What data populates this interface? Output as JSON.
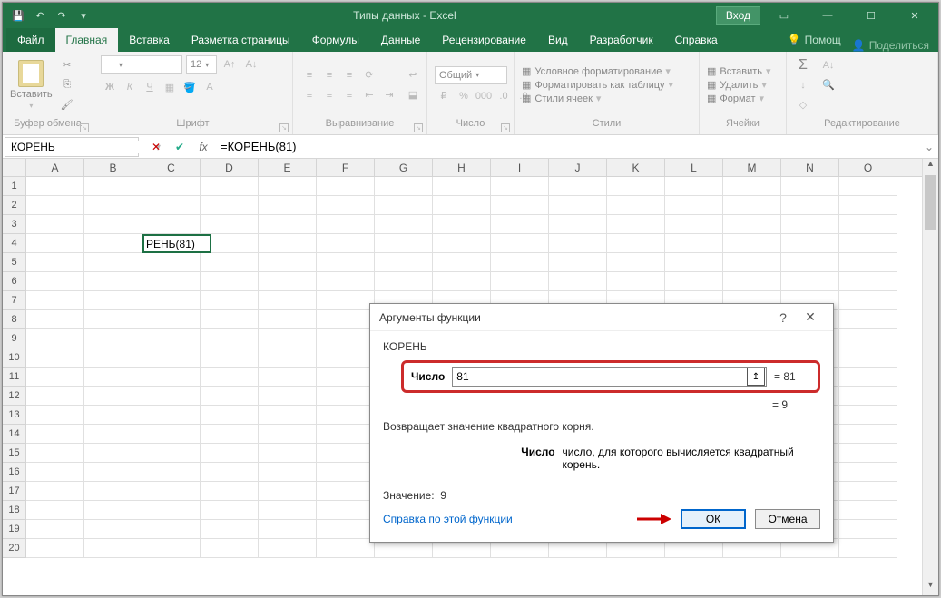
{
  "title": "Типы данных - Excel",
  "login": "Вход",
  "tabs": {
    "file": "Файл",
    "home": "Главная",
    "insert": "Вставка",
    "layout": "Разметка страницы",
    "formulas": "Формулы",
    "data": "Данные",
    "review": "Рецензирование",
    "view": "Вид",
    "dev": "Разработчик",
    "help": "Справка",
    "tell": "Помощ",
    "share": "Поделиться"
  },
  "ribbon": {
    "paste": "Вставить",
    "clipboard": "Буфер обмена",
    "font": "Шрифт",
    "fontsize": "12",
    "font_group": "Шрифт",
    "align_group": "Выравнивание",
    "number_group": "Число",
    "number_format": "Общий",
    "styles_group": "Стили",
    "cond_fmt": "Условное форматирование",
    "as_table": "Форматировать как таблицу",
    "cell_styles": "Стили ячеек",
    "cells_group": "Ячейки",
    "insert_c": "Вставить",
    "delete_c": "Удалить",
    "format_c": "Формат",
    "edit_group": "Редактирование"
  },
  "namebox": "КОРЕНЬ",
  "formula": "=КОРЕНЬ(81)",
  "columns": [
    "A",
    "B",
    "C",
    "D",
    "E",
    "F",
    "G",
    "H",
    "I",
    "J",
    "K",
    "L",
    "M",
    "N",
    "O"
  ],
  "rows_count": 20,
  "active_cell_text": "РЕНЬ(81)",
  "dialog": {
    "title": "Аргументы функции",
    "fn": "КОРЕНЬ",
    "arg_label": "Число",
    "arg_value": "81",
    "arg_eval": "= 81",
    "result_line": "= 9",
    "desc": "Возвращает значение квадратного корня.",
    "arg_desc_label": "Число",
    "arg_desc_text": "число, для которого вычисляется квадратный корень.",
    "value_label": "Значение:",
    "value": "9",
    "help": "Справка по этой функции",
    "ok": "ОК",
    "cancel": "Отмена"
  }
}
